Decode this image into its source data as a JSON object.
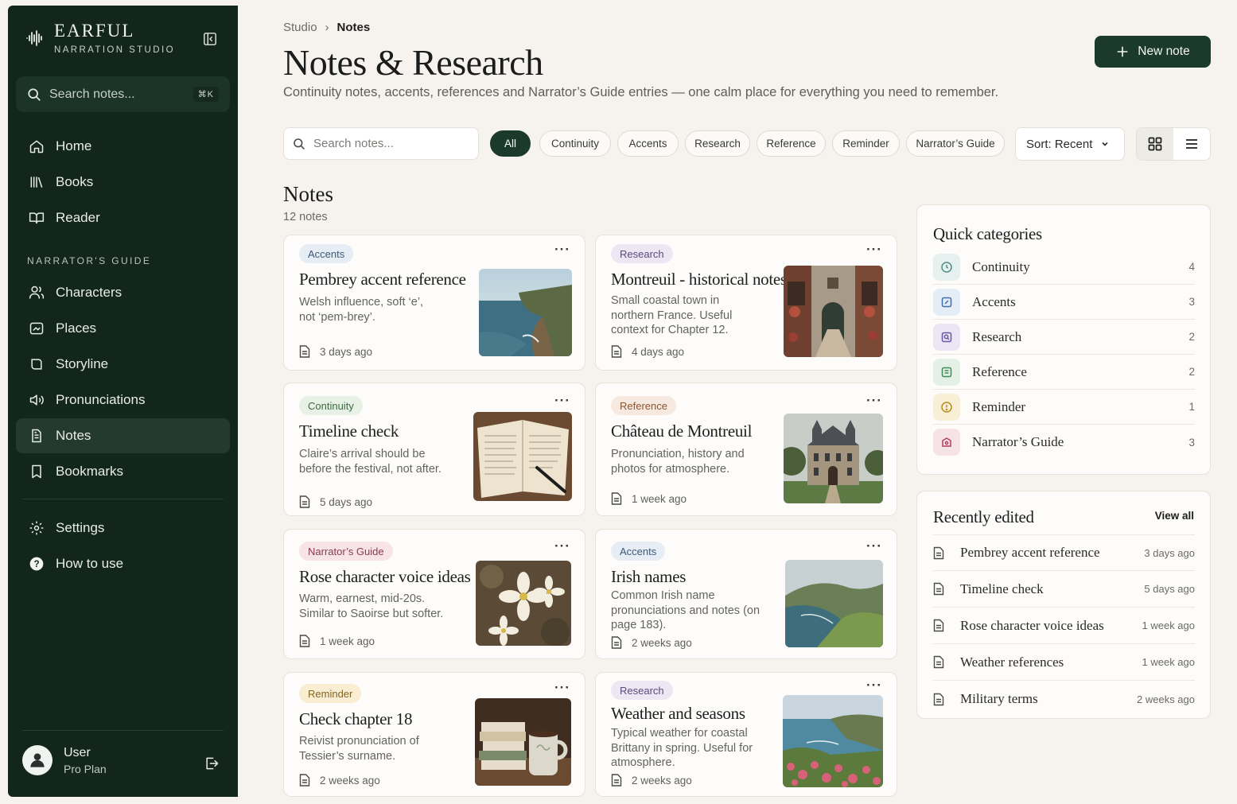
{
  "sidebar": {
    "brand_name": "EARFUL",
    "brand_sub": "NARRATION STUDIO",
    "search_placeholder": "Search notes...",
    "search_shortcut": "⌘K",
    "main_nav": [
      {
        "label": "Home",
        "icon": "home-icon"
      },
      {
        "label": "Books",
        "icon": "books-icon"
      },
      {
        "label": "Reader",
        "icon": "book-open-icon"
      }
    ],
    "guide_title": "NARRATOR'S GUIDE",
    "guide_nav": [
      {
        "label": "Characters",
        "icon": "users-icon"
      },
      {
        "label": "Places",
        "icon": "map-icon"
      },
      {
        "label": "Storyline",
        "icon": "storyline-icon"
      },
      {
        "label": "Pronunciations",
        "icon": "speaker-icon"
      },
      {
        "label": "Notes",
        "icon": "notes-icon",
        "active": true
      },
      {
        "label": "Bookmarks",
        "icon": "bookmark-icon"
      }
    ],
    "bottom_nav": [
      {
        "label": "Settings",
        "icon": "gear-icon"
      },
      {
        "label": "How to use",
        "icon": "help-icon"
      }
    ],
    "user": {
      "name": "User",
      "plan": "Pro Plan"
    }
  },
  "header": {
    "breadcrumb": [
      "Studio",
      "Notes"
    ],
    "title": "Notes & Research",
    "subtitle": "Continuity notes, accents, references and Narrator’s Guide entries — one calm place for everything you need to remember.",
    "new_button": "New note"
  },
  "filters": {
    "search_placeholder": "Search notes...",
    "chips": [
      "All",
      "Continuity",
      "Accents",
      "Research",
      "Reference",
      "Reminder",
      "Narrator’s Guide"
    ],
    "active_chip": "All",
    "sort_label": "Sort: Recent",
    "view": "grid"
  },
  "notes": {
    "heading": "Notes",
    "count": "12 notes",
    "items": [
      {
        "tag": "Accents",
        "title": "Pembrey accent reference",
        "desc": "Welsh influence, soft ‘e’, not ‘pem-brey’.",
        "date": "3 days ago",
        "image": "coastal cliffs"
      },
      {
        "tag": "Research",
        "title": "Montreuil - historical notes",
        "desc": "Small coastal town in northern France. Useful context for Chapter 12.",
        "date": "4 days ago",
        "image": "stone alley with archway"
      },
      {
        "tag": "Continuity",
        "title": "Timeline check",
        "desc": "Claire’s arrival should be before the festival, not after.",
        "date": "5 days ago",
        "image": "open notebook with pen"
      },
      {
        "tag": "Reference",
        "title": "Château de Montreuil",
        "desc": "Pronunciation, history and photos for atmosphere.",
        "date": "1 week ago",
        "image": "chateau"
      },
      {
        "tag": "Narrator’s Guide",
        "title": "Rose character voice ideas",
        "desc": "Warm, earnest, mid-20s. Similar to Saoirse but softer.",
        "date": "1 week ago",
        "image": "white flowers"
      },
      {
        "tag": "Accents",
        "title": "Irish names",
        "desc": "Common Irish name pronunciations and notes (on page 183).",
        "date": "2 weeks ago",
        "image": "green coastal hills"
      },
      {
        "tag": "Reminder",
        "title": "Check chapter 18",
        "desc": "Reivist pronunciation of Tessier’s surname.",
        "date": "2 weeks ago",
        "image": "books and mug"
      },
      {
        "tag": "Research",
        "title": "Weather and seasons",
        "desc": "Typical weather for coastal Brittany in spring. Useful for atmosphere.",
        "date": "2 weeks ago",
        "image": "coast with pink flowers"
      }
    ]
  },
  "quick_categories": {
    "title": "Quick categories",
    "items": [
      {
        "label": "Continuity",
        "count": "4",
        "color": "#4f8a8b"
      },
      {
        "label": "Accents",
        "count": "3",
        "color": "#3e6fa8"
      },
      {
        "label": "Research",
        "count": "2",
        "color": "#6b55a3"
      },
      {
        "label": "Reference",
        "count": "2",
        "color": "#3f8a55"
      },
      {
        "label": "Reminder",
        "count": "1",
        "color": "#b88a1c"
      },
      {
        "label": "Narrator’s Guide",
        "count": "3",
        "color": "#b0405e"
      }
    ]
  },
  "recent": {
    "title": "Recently edited",
    "view_all": "View all",
    "items": [
      {
        "title": "Pembrey accent reference",
        "date": "3 days ago"
      },
      {
        "title": "Timeline check",
        "date": "5 days ago"
      },
      {
        "title": "Rose character voice ideas",
        "date": "1 week ago"
      },
      {
        "title": "Weather references",
        "date": "1 week ago"
      },
      {
        "title": "Military terms",
        "date": "2 weeks ago"
      }
    ]
  }
}
